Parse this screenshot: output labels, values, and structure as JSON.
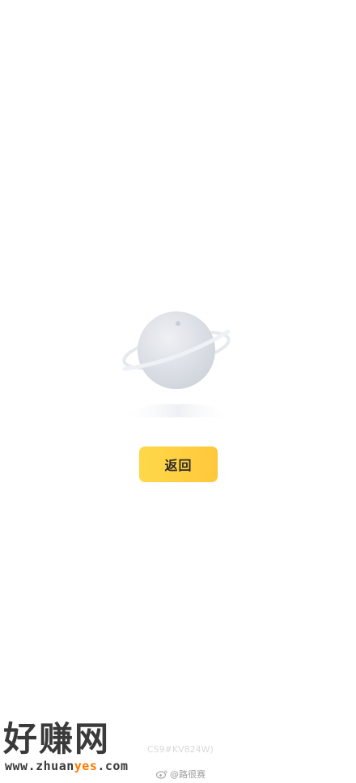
{
  "empty_state": {
    "illustration": "planet-icon"
  },
  "actions": {
    "back_label": "返回"
  },
  "footer": {
    "code_text": "CS9#KV824W)",
    "weibo_handle": "@路很赛"
  },
  "watermark": {
    "title": "好赚网",
    "url_prefix": "www.zhuan",
    "url_accent": "yes",
    "url_suffix": ".com"
  },
  "colors": {
    "button": "#ffd03f",
    "button_text": "#2b2b2b",
    "planet": "#dfe3e9",
    "accent": "#ff7a00"
  }
}
